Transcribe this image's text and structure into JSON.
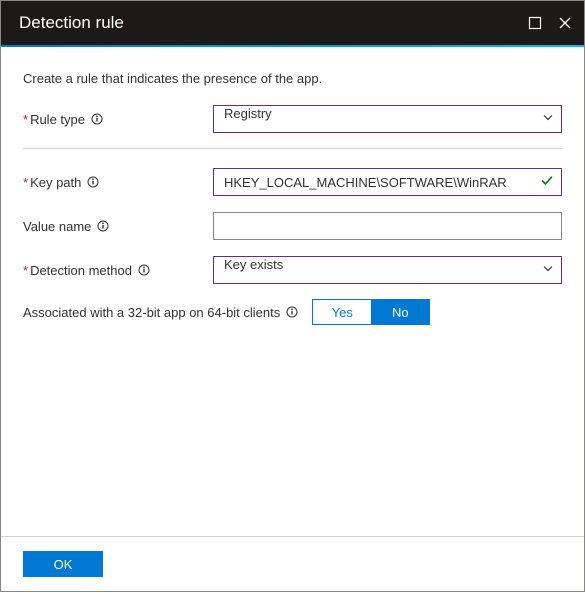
{
  "header": {
    "title": "Detection rule"
  },
  "instruction": "Create a rule that indicates the presence of the app.",
  "fields": {
    "rule_type": {
      "label": "Rule type",
      "value": "Registry"
    },
    "key_path": {
      "label": "Key path",
      "value": "HKEY_LOCAL_MACHINE\\SOFTWARE\\WinRAR"
    },
    "value_name": {
      "label": "Value name",
      "value": ""
    },
    "detection_method": {
      "label": "Detection method",
      "value": "Key exists"
    }
  },
  "toggle": {
    "label": "Associated with a 32-bit app on 64-bit clients",
    "yes": "Yes",
    "no": "No",
    "selected": "No"
  },
  "footer": {
    "ok": "OK"
  }
}
